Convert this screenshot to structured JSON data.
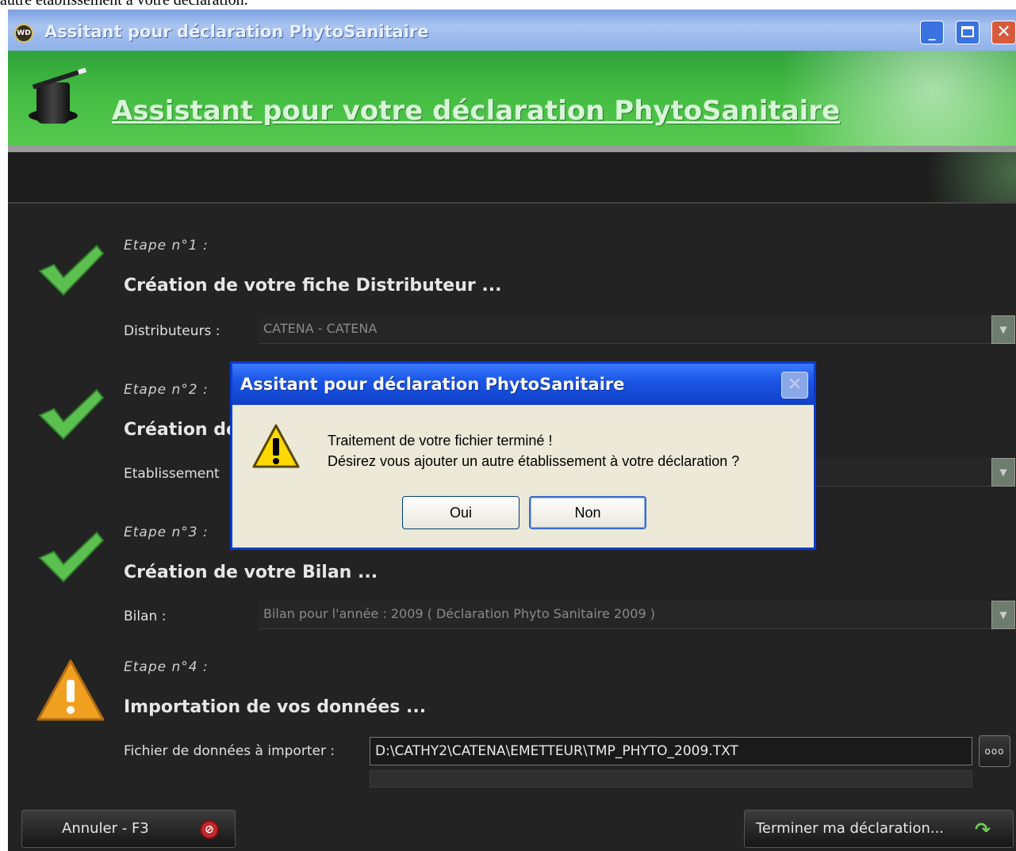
{
  "page": {
    "caption": "autre établissement à votre déclaration."
  },
  "window": {
    "title": "Assitant pour déclaration PhytoSanitaire",
    "controls": {
      "minimize": "_",
      "close": "✕"
    }
  },
  "banner": {
    "title": "Assistant pour votre déclaration PhytoSanitaire"
  },
  "steps": [
    {
      "label": "Etape n°1 :",
      "title": "Création de votre fiche Distributeur ...",
      "field_label": "Distributeurs :",
      "value": "CATENA - CATENA",
      "status": "done"
    },
    {
      "label": "Etape n°2 :",
      "title": "Création de",
      "field_label": "Etablissement",
      "value": "",
      "status": "done"
    },
    {
      "label": "Etape n°3 :",
      "title": "Création de votre Bilan ...",
      "field_label": "Bilan :",
      "value": "Bilan pour l'année : 2009 ( Déclaration Phyto Sanitaire 2009 )",
      "status": "done"
    },
    {
      "label": "Etape n°4 :",
      "title": "Importation de vos données ...",
      "field_label": "Fichier de données à importer :",
      "value": "D:\\CATHY2\\CATENA\\EMETTEUR\\TMP_PHYTO_2009.TXT",
      "status": "warning",
      "browse_label": "ooo",
      "progress": 0
    }
  ],
  "footer": {
    "cancel_label": "Annuler - F3",
    "finish_label": "Terminer ma déclaration..."
  },
  "dialog": {
    "title": "Assitant pour déclaration PhytoSanitaire",
    "close": "✕",
    "message_line1": "Traitement de votre fichier terminé !",
    "message_line2": "Désirez vous ajouter un autre établissement à votre déclaration ?",
    "yes_label": "Oui",
    "no_label": "Non"
  },
  "colors": {
    "banner_green": "#46be44",
    "background": "#232323",
    "dialog_blue": "#1b56e6",
    "check_green": "#5cc050",
    "warning_orange": "#f0a020"
  }
}
